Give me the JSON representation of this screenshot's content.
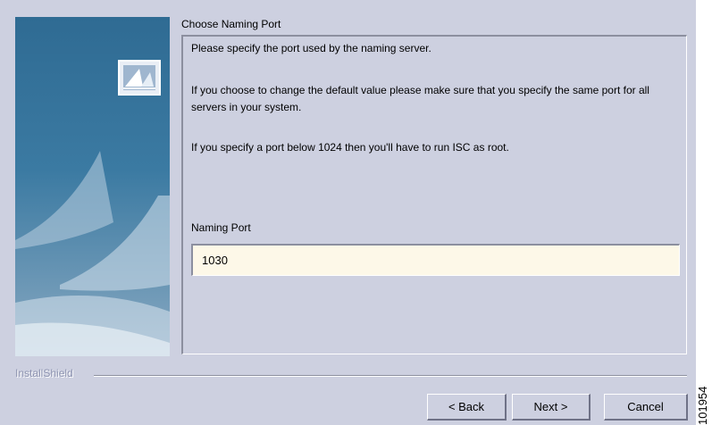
{
  "dialog": {
    "step_title": "Choose Naming Port",
    "paragraphs": [
      "Please specify the port used by the naming server.",
      "If you choose to change the default value please make sure that you specify the same port for all servers in your system.",
      "If you specify a port  below 1024 then you'll have to run ISC as root."
    ],
    "field_label": "Naming Port",
    "field_value": "1030"
  },
  "footer": {
    "brand": "InstallShield",
    "back_label": "< Back",
    "next_label": "Next >",
    "cancel_label": "Cancel"
  },
  "figure_id": "101954",
  "colors": {
    "window_bg": "#cdd0e0",
    "input_bg": "#fdf8e8",
    "banner_blue": "#2f6b93"
  },
  "icons": {
    "banner": "installer-sail-graphic",
    "logo": "installshield-logo-icon"
  }
}
